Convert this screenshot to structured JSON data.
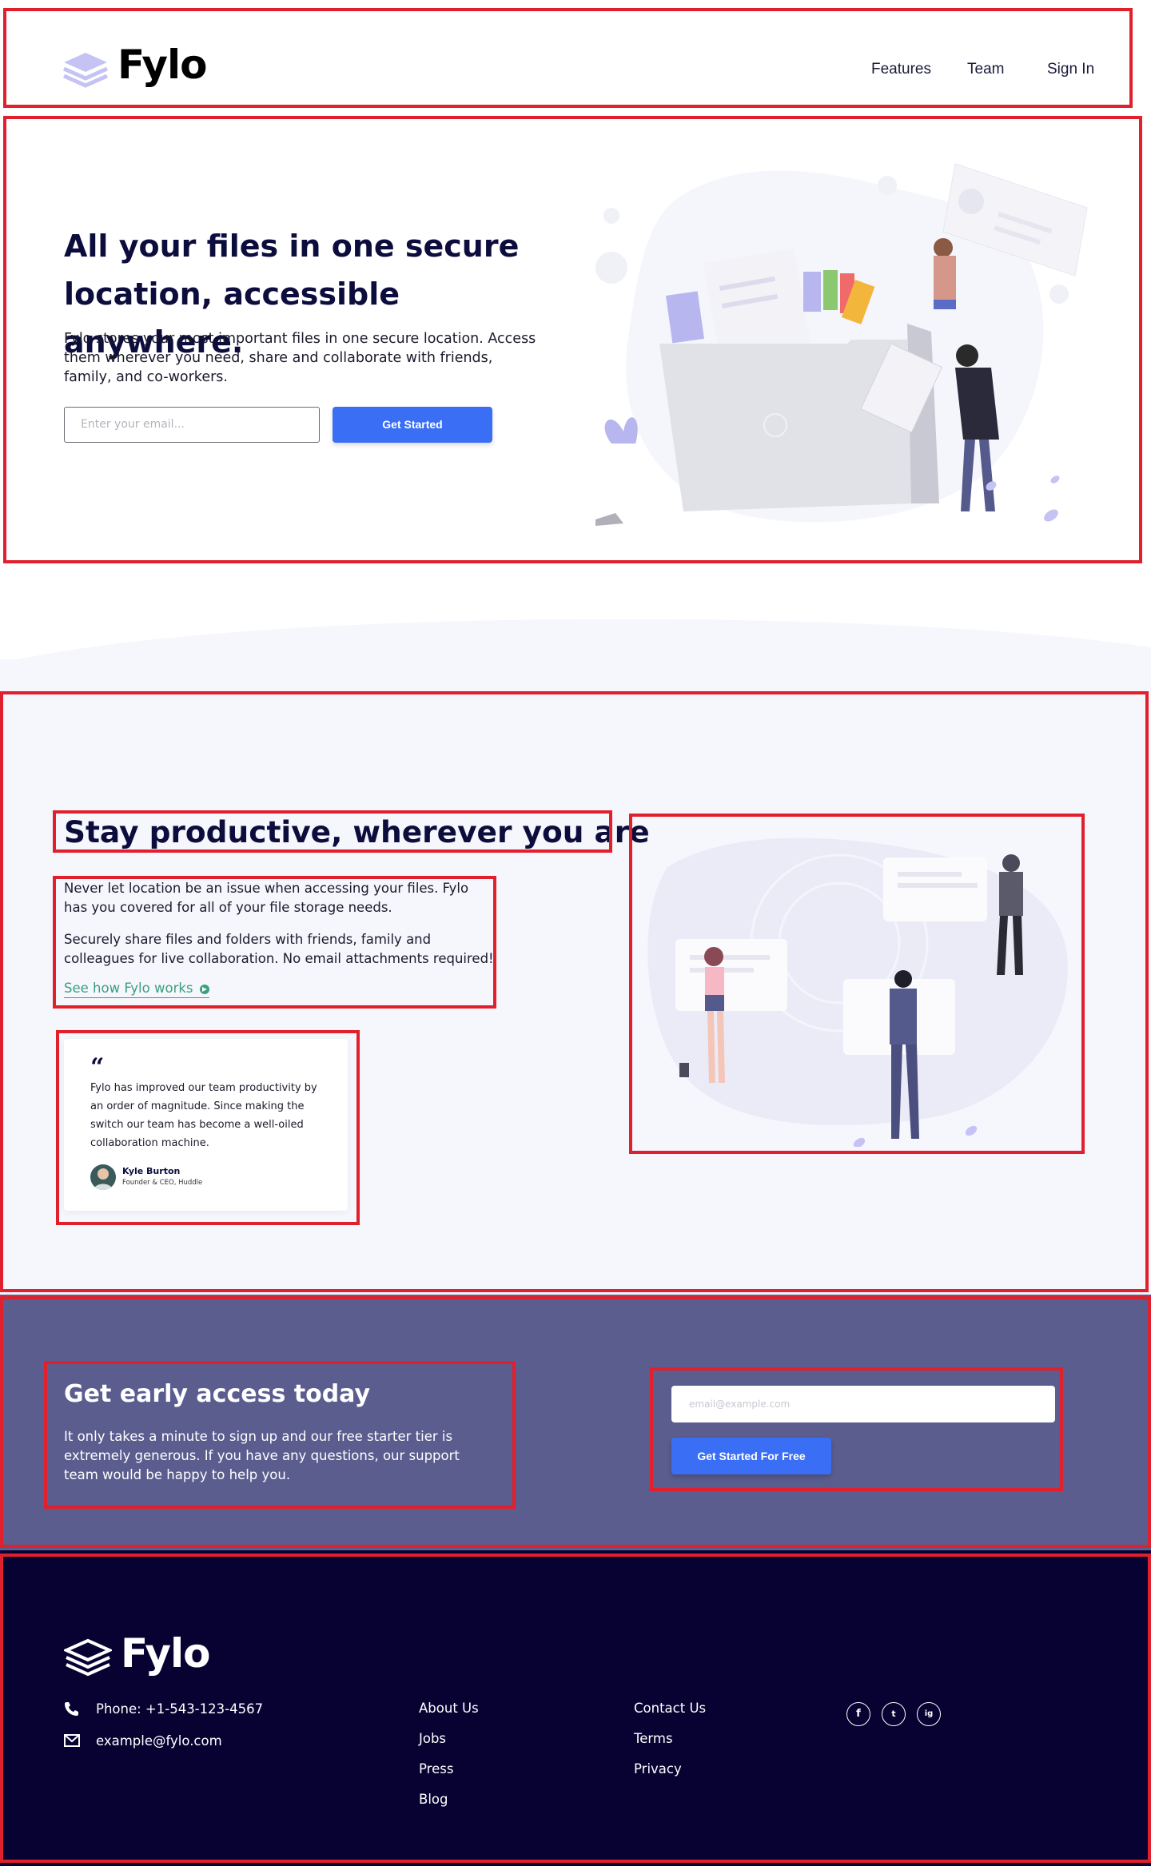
{
  "header": {
    "brand": "Fylo",
    "nav": [
      "Features",
      "Team",
      "Sign In"
    ]
  },
  "hero": {
    "title": "All your files in one secure location, accessible anywhere.",
    "text": "Fylo stores your most important files in one secure location. Access them wherever you need, share and collaborate with friends, family, and co-workers.",
    "email_placeholder": "Enter your email...",
    "cta": "Get Started"
  },
  "productive": {
    "title": "Stay productive, wherever you are",
    "p1": "Never let location be an issue when accessing your files. Fylo has you covered for all of your file storage needs.",
    "p2": "Securely share files and folders with friends, family and colleagues for live collaboration. No email attachments required!",
    "link": "See how Fylo works"
  },
  "testimonial": {
    "quote_mark": "“",
    "text": "Fylo has improved our team productivity by an order of magnitude. Since making the switch our team has become a well-oiled collaboration machine.",
    "name": "Kyle Burton",
    "role": "Founder & CEO, Huddle"
  },
  "early": {
    "title": "Get early access today",
    "text": "It only takes a minute to sign up and our free starter tier is extremely generous. If you have any questions, our support team would be happy to help you.",
    "email_placeholder": "email@example.com",
    "cta": "Get Started For Free"
  },
  "footer": {
    "brand": "Fylo",
    "phone": "Phone: +1-543-123-4567",
    "email": "example@fylo.com",
    "col1": [
      "About Us",
      "Jobs",
      "Press",
      "Blog"
    ],
    "col2": [
      "Contact Us",
      "Terms",
      "Privacy"
    ],
    "social": [
      "f",
      "t",
      "ig"
    ]
  },
  "colors": {
    "accent": "#3a6ff5",
    "link": "#3aa07d",
    "early_bg": "#5a5d8e",
    "footer_bg": "#080233",
    "annotation": "#e0202c"
  },
  "icons": [
    "fylo-logo-icon",
    "phone-icon",
    "email-icon",
    "facebook-icon",
    "twitter-icon",
    "instagram-icon",
    "arrow-right-icon",
    "quote-icon"
  ]
}
